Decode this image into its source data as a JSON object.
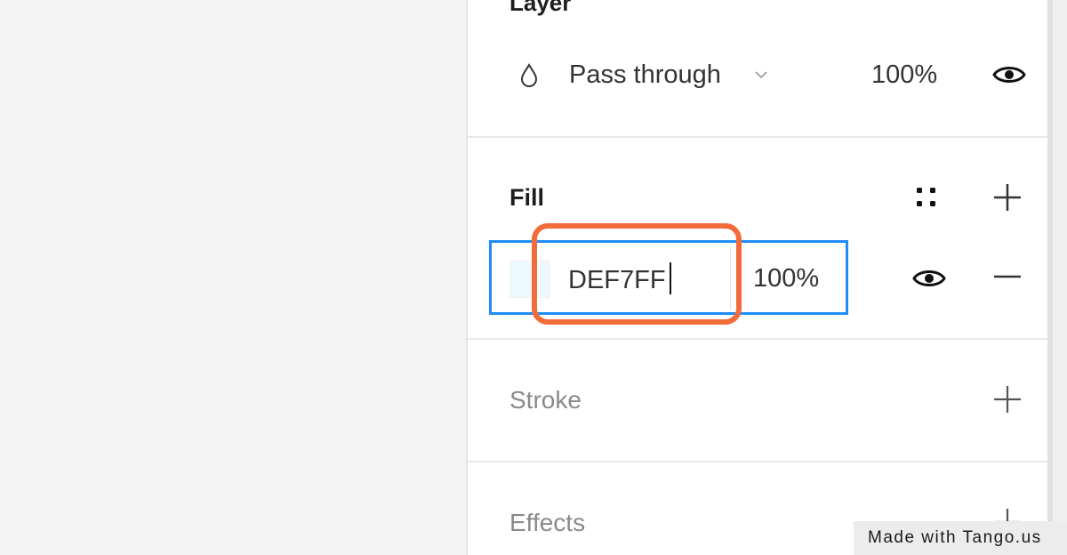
{
  "layer": {
    "title": "Layer",
    "blend_mode": "Pass through",
    "opacity": "100%",
    "icons": {
      "blend": "drop-icon",
      "chevron": "chevron-down-icon",
      "visibility": "eye-icon"
    }
  },
  "fill": {
    "title": "Fill",
    "hex_value": "DEF7FF",
    "opacity": "100%",
    "swatch_color": "#DEF7FF",
    "icons": {
      "styles": "styles-grid-icon",
      "add": "plus-icon",
      "visibility": "eye-icon",
      "remove": "minus-icon"
    }
  },
  "stroke": {
    "title": "Stroke",
    "icons": {
      "add": "plus-icon"
    }
  },
  "effects": {
    "title": "Effects",
    "icons": {
      "add": "plus-icon"
    }
  },
  "colors": {
    "focus_border": "#1F8DF5",
    "highlight": "#F26B3A"
  },
  "watermark": {
    "text": "Made with Tango.us"
  }
}
